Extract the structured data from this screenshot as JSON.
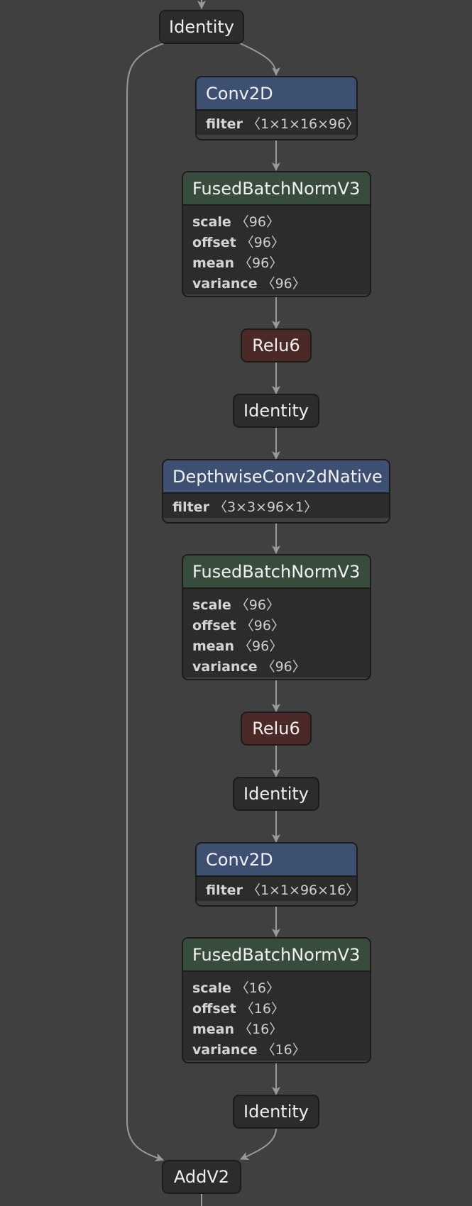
{
  "nodes": [
    {
      "id": "n0",
      "kind": "simple",
      "label": "Identity"
    },
    {
      "id": "n1",
      "kind": "op",
      "color": "#3e5072",
      "label": "Conv2D",
      "attrs": [
        {
          "name": "filter",
          "shape": "〈1×1×16×96〉"
        }
      ]
    },
    {
      "id": "n2",
      "kind": "op",
      "color": "#384c3e",
      "label": "FusedBatchNormV3",
      "attrs": [
        {
          "name": "scale",
          "shape": "〈96〉"
        },
        {
          "name": "offset",
          "shape": "〈96〉"
        },
        {
          "name": "mean",
          "shape": "〈96〉"
        },
        {
          "name": "variance",
          "shape": "〈96〉"
        }
      ]
    },
    {
      "id": "n3",
      "kind": "simple",
      "label": "Relu6",
      "color": "#4a2927"
    },
    {
      "id": "n4",
      "kind": "simple",
      "label": "Identity"
    },
    {
      "id": "n5",
      "kind": "op",
      "color": "#3e5072",
      "label": "DepthwiseConv2dNative",
      "attrs": [
        {
          "name": "filter",
          "shape": "〈3×3×96×1〉"
        }
      ]
    },
    {
      "id": "n6",
      "kind": "op",
      "color": "#384c3e",
      "label": "FusedBatchNormV3",
      "attrs": [
        {
          "name": "scale",
          "shape": "〈96〉"
        },
        {
          "name": "offset",
          "shape": "〈96〉"
        },
        {
          "name": "mean",
          "shape": "〈96〉"
        },
        {
          "name": "variance",
          "shape": "〈96〉"
        }
      ]
    },
    {
      "id": "n7",
      "kind": "simple",
      "label": "Relu6",
      "color": "#4a2927"
    },
    {
      "id": "n8",
      "kind": "simple",
      "label": "Identity"
    },
    {
      "id": "n9",
      "kind": "op",
      "color": "#3e5072",
      "label": "Conv2D",
      "attrs": [
        {
          "name": "filter",
          "shape": "〈1×1×96×16〉"
        }
      ]
    },
    {
      "id": "n10",
      "kind": "op",
      "color": "#384c3e",
      "label": "FusedBatchNormV3",
      "attrs": [
        {
          "name": "scale",
          "shape": "〈16〉"
        },
        {
          "name": "offset",
          "shape": "〈16〉"
        },
        {
          "name": "mean",
          "shape": "〈16〉"
        },
        {
          "name": "variance",
          "shape": "〈16〉"
        }
      ]
    },
    {
      "id": "n11",
      "kind": "simple",
      "label": "Identity"
    },
    {
      "id": "n12",
      "kind": "simple",
      "label": "AddV2"
    }
  ],
  "edges": [
    [
      "n0",
      "n1"
    ],
    [
      "n1",
      "n2"
    ],
    [
      "n2",
      "n3"
    ],
    [
      "n3",
      "n4"
    ],
    [
      "n4",
      "n5"
    ],
    [
      "n5",
      "n6"
    ],
    [
      "n6",
      "n7"
    ],
    [
      "n7",
      "n8"
    ],
    [
      "n8",
      "n9"
    ],
    [
      "n9",
      "n10"
    ],
    [
      "n10",
      "n11"
    ],
    [
      "n11",
      "n12"
    ],
    [
      "n0",
      "n12"
    ]
  ]
}
